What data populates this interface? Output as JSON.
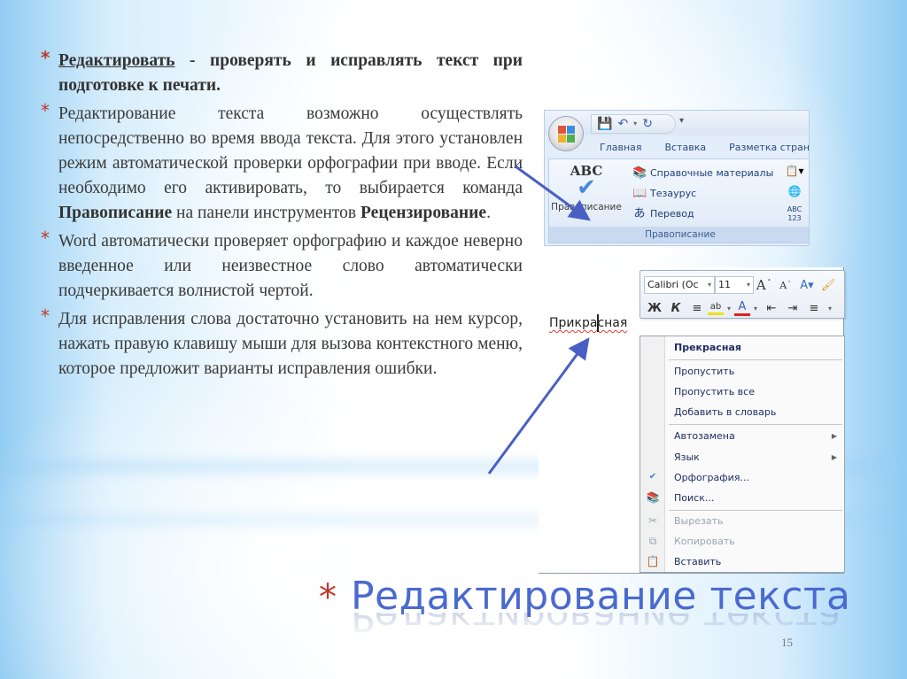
{
  "slide": {
    "title": "Редактирование текста",
    "page_number": "15",
    "bullet_marker": "*",
    "colors": {
      "title": "#4a6ad0",
      "bullet_marker": "#c0392b",
      "body_text": "#3a3a3a",
      "arrow": "#4a5fc4"
    }
  },
  "bullets": [
    {
      "term": "Редактировать",
      "rest": " - проверять и исправлять текст при подготовке к печати."
    },
    {
      "text_before_1": "Редактирование текста возможно  осуществлять непосредственно во время ввода текста. Для этого установлен режим автоматической проверки орфографии при вводе. Если необходимо его активировать, то выбирается команда ",
      "bold_1": "Правописание",
      "text_between": " на панели инструментов ",
      "bold_2": "Рецензирование",
      "text_after": "."
    },
    {
      "text": "Word автоматически проверяет орфографию и каждое неверно введенное или неизвестное слово автоматически подчеркивается волнистой чертой."
    },
    {
      "text": "Для исправления слова достаточно установить на нем курсор, нажать правую клавишу мыши для вызова контекстного меню, которое предложит варианты исправления ошибки."
    }
  ],
  "ribbon": {
    "quick_access": [
      "save-icon",
      "undo-icon",
      "redo-icon"
    ],
    "tabs": [
      "Главная",
      "Вставка",
      "Разметка стран"
    ],
    "big_button": {
      "icon_text": "ABC",
      "label": "Правописание"
    },
    "small_buttons": [
      {
        "icon": "books-icon",
        "label": "Справочные материалы"
      },
      {
        "icon": "thesaurus-icon",
        "label": "Тезаурус"
      },
      {
        "icon": "translate-icon",
        "label": "Перевод"
      }
    ],
    "side_icons": [
      "language-icon",
      "globe-icon",
      "word-count-icon"
    ],
    "word_count_icon_text": "ABC 123",
    "group_label": "Правописание"
  },
  "mini_toolbar": {
    "font_name": "Calibri (Ос",
    "font_size": "11",
    "bold": "Ж",
    "italic": "К"
  },
  "document": {
    "misspelled_word": "Прикрасная"
  },
  "context_menu": {
    "items": [
      {
        "label": "Прекрасная",
        "bold": true
      },
      {
        "label": "Пропустить"
      },
      {
        "label": "Пропустить все"
      },
      {
        "label": "Добавить в словарь"
      },
      {
        "label": "Автозамена",
        "submenu": true
      },
      {
        "label": "Язык",
        "submenu": true
      },
      {
        "label": "Орфография...",
        "icon": "spelling-icon"
      },
      {
        "label": "Поиск...",
        "icon": "research-icon"
      },
      {
        "label": "Вырезать",
        "icon": "cut-icon",
        "disabled": true
      },
      {
        "label": "Копировать",
        "icon": "copy-icon",
        "disabled": true
      },
      {
        "label": "Вставить",
        "icon": "paste-icon"
      }
    ]
  }
}
